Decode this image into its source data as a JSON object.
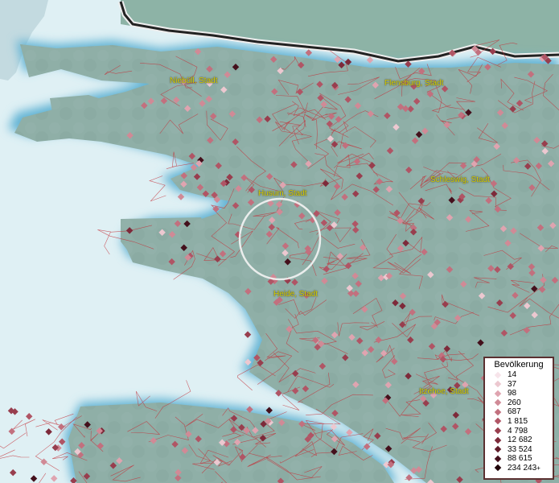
{
  "map": {
    "colors": {
      "land": "#8daca4",
      "water": "#dff0f4",
      "coast_glow": "#6fb8d2",
      "border_line": "#d43030",
      "district_line": "#8b3a3a",
      "national_border": "#222222",
      "label": "#d8d200"
    },
    "cities": [
      {
        "id": "niebuell",
        "name": "Niebüll, Stadt"
      },
      {
        "id": "flensburg",
        "name": "Flensburg, Stadt"
      },
      {
        "id": "schleswig",
        "name": "Schleswig, Stadt"
      },
      {
        "id": "husum",
        "name": "Husum, Stadt"
      },
      {
        "id": "heide",
        "name": "Heide, Stadt"
      },
      {
        "id": "itzehoe",
        "name": "Itzehoe, Stadt"
      }
    ]
  },
  "legend": {
    "title": "Bevölkerung",
    "items": [
      {
        "value": "14",
        "color": "#f7e4ea"
      },
      {
        "value": "37",
        "color": "#ecc8d0"
      },
      {
        "value": "98",
        "color": "#dfa4b0"
      },
      {
        "value": "260",
        "color": "#d08a96"
      },
      {
        "value": "687",
        "color": "#c2707e"
      },
      {
        "value": "1 815",
        "color": "#b05565"
      },
      {
        "value": "4 798",
        "color": "#983e4e"
      },
      {
        "value": "12 682",
        "color": "#7d2a3a"
      },
      {
        "value": "33 524",
        "color": "#601c2a"
      },
      {
        "value": "88 615",
        "color": "#44101c"
      },
      {
        "value": "234 243",
        "color": "#1f0408"
      }
    ],
    "last_suffix": "+"
  }
}
